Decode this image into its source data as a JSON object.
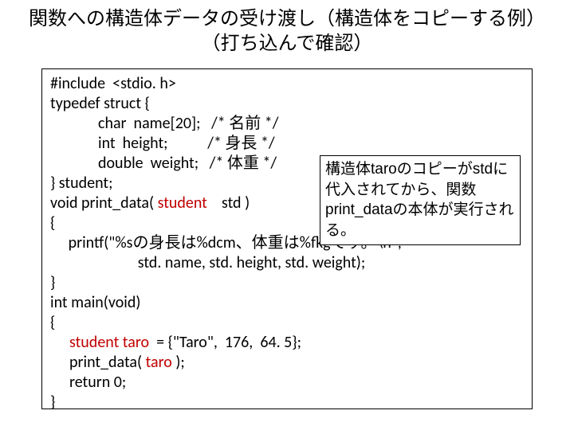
{
  "title": {
    "line1": "関数への構造体データの受け渡し（構造体をコピーする例）",
    "line2": "（打ち込んで確認）"
  },
  "code": {
    "l1": "#include  <stdio. h>",
    "l2": "typedef struct {",
    "l3": "char  name[20];   /* 名前 */",
    "l4": "int  height;           /* 身長 */",
    "l5": "double  weight;   /* 体重 */",
    "l6": "} student;",
    "l7a": "void print_data( ",
    "l7b": "student",
    "l7c": "    std )",
    "l8": "{",
    "l9": "     printf(\"%sの身長は%dcm、体重は%fkgです。\\n\",",
    "l10": "           std. name, std. height, std. weight);",
    "l11": "}",
    "l12": "int main(void)",
    "l13": "{",
    "l14a": "student taro",
    "l14b": "  = {\"Taro\",  176,  64. 5};",
    "l15a": "print_data( ",
    "l15b": "taro",
    "l15c": " );",
    "l16": "return 0;",
    "l17": "}"
  },
  "note": {
    "text": "構造体taroのコピーがstdに代入されてから、関数print_dataの本体が実行される。"
  }
}
